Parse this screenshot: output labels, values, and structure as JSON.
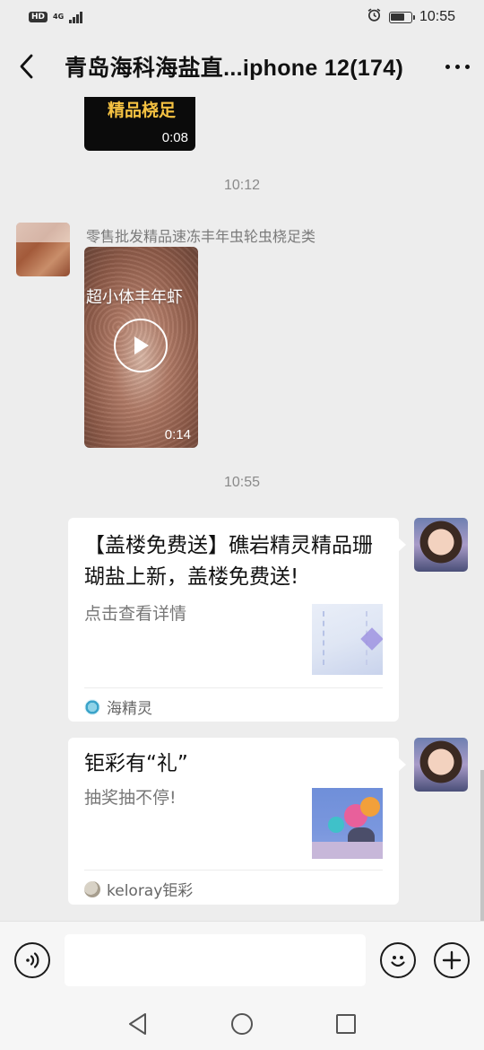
{
  "status_bar": {
    "network_badge": "HD",
    "network_type": "4G",
    "time": "10:55",
    "battery_level": 0.7,
    "icons": [
      "hd-icon",
      "signal-icon",
      "alarm-icon",
      "battery-icon"
    ]
  },
  "header": {
    "title": "青岛海科海盐直...iphone 12(174)",
    "back_icon": "back-arrow-icon",
    "more_icon": "more-dots-icon"
  },
  "messages": [
    {
      "type": "video",
      "caption": "精品桡足",
      "duration": "0:08"
    },
    {
      "type": "timestamp",
      "text": "10:12"
    },
    {
      "type": "video",
      "sender": "零售批发精品速冻丰年虫轮虫桡足类",
      "caption": "超小体丰年虾",
      "duration": "0:14"
    },
    {
      "type": "timestamp",
      "text": "10:55"
    },
    {
      "type": "card",
      "title": "【盖楼免费送】礁岩精灵精品珊瑚盐上新，盖楼免费送!",
      "desc": "点击查看详情",
      "source": "海精灵"
    },
    {
      "type": "card",
      "title": "钜彩有“礼”",
      "desc": "抽奖抽不停!",
      "source": "keloray钜彩"
    }
  ],
  "input_bar": {
    "placeholder": "",
    "voice_icon": "voice-icon",
    "emoji_icon": "emoji-icon",
    "add_icon": "plus-icon"
  },
  "nav_bar": {
    "icons": [
      "nav-back-icon",
      "nav-home-icon",
      "nav-recents-icon"
    ]
  },
  "colors": {
    "background": "#ededed",
    "bubble": "#ffffff",
    "timestamp": "#8a8a8a",
    "caption_gold": "#f5c242"
  }
}
